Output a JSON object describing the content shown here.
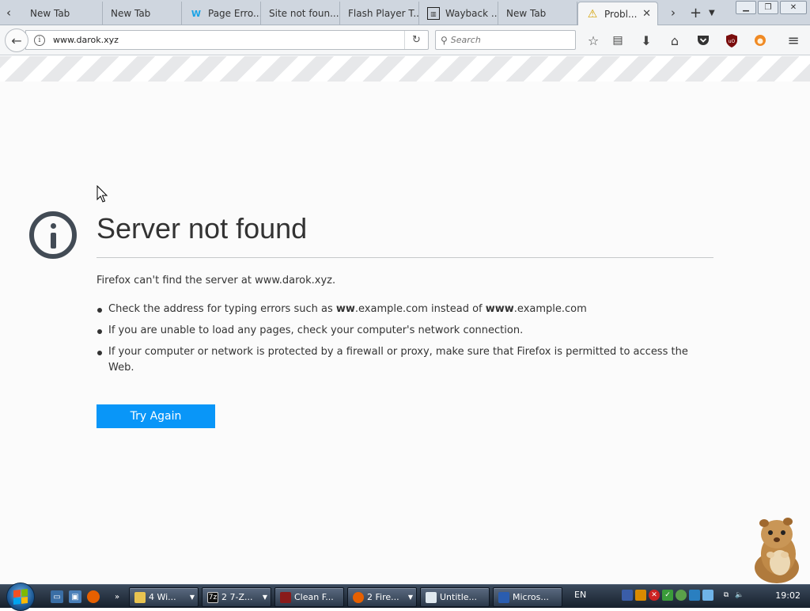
{
  "browser": {
    "tabs": [
      {
        "label": "New Tab",
        "icon": "blank-icon"
      },
      {
        "label": "New Tab",
        "icon": "blank-icon"
      },
      {
        "label": "Page Erro...",
        "icon": "wiki-icon"
      },
      {
        "label": "Site not foun...",
        "icon": "blank-icon"
      },
      {
        "label": "Flash Player T...",
        "icon": "blank-icon"
      },
      {
        "label": "Wayback ...",
        "icon": "archive-icon"
      },
      {
        "label": "New Tab",
        "icon": "blank-icon"
      },
      {
        "label": "Probl...",
        "icon": "warning-icon",
        "active": true
      }
    ],
    "url": "www.darok.xyz",
    "search_placeholder": "Search"
  },
  "error_page": {
    "title": "Server not found",
    "lead": "Firefox can't find the server at www.darok.xyz.",
    "bullet1_pre": "Check the address for typing errors such as ",
    "bullet1_bold1": "ww",
    "bullet1_mid": ".example.com instead of ",
    "bullet1_bold2": "www",
    "bullet1_post": ".example.com",
    "bullet2": "If you are unable to load any pages, check your computer's network connection.",
    "bullet3": "If your computer or network is protected by a firewall or proxy, make sure that Firefox is permitted to access the Web.",
    "try_again": "Try Again"
  },
  "taskbar": {
    "tasks": [
      {
        "label": "4 Wi...",
        "icon": "folder-icon"
      },
      {
        "label": "2 7-Z...",
        "icon": "7zip-icon"
      },
      {
        "label": "Clean F...",
        "icon": "app-icon"
      },
      {
        "label": "2 Fire...",
        "icon": "firefox-icon"
      },
      {
        "label": "Untitle...",
        "icon": "notepad-icon"
      },
      {
        "label": "Micros...",
        "icon": "movie-maker-icon"
      }
    ],
    "lang": "EN",
    "clock": "19:02"
  },
  "colors": {
    "accent": "#0996f8",
    "text": "#333333"
  }
}
